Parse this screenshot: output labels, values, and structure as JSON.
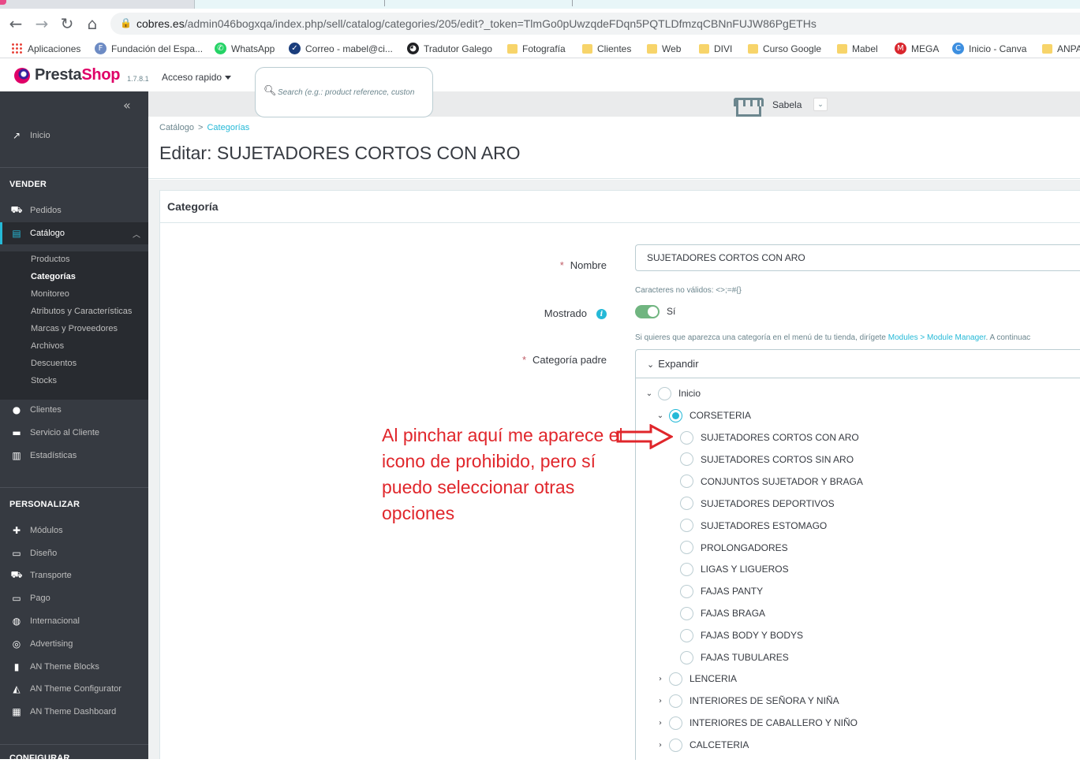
{
  "browser": {
    "url_host": "cobres.es",
    "url_path": "/admin046bogxqa/index.php/sell/catalog/categories/205/edit?_token=TlmGo0pUwzqdeFDqn5PQTLDfmzqCBNnFUJW86PgETHs",
    "bookmarks": [
      {
        "label": "Aplicaciones",
        "icon": "apps-grid-icon"
      },
      {
        "label": "Fundación del Espa...",
        "icon": "f-circle-icon",
        "color": "#6d8bc4"
      },
      {
        "label": "WhatsApp",
        "icon": "whatsapp-icon",
        "color": "#25d366"
      },
      {
        "label": "Correo - mabel@ci...",
        "icon": "mail-icon",
        "color": "#1a3d7c"
      },
      {
        "label": "Tradutor Galego",
        "icon": "globe-icon",
        "color": "#202124"
      },
      {
        "label": "Fotografía",
        "icon": "folder-icon"
      },
      {
        "label": "Clientes",
        "icon": "folder-icon"
      },
      {
        "label": "Web",
        "icon": "folder-icon"
      },
      {
        "label": "DIVI",
        "icon": "folder-icon"
      },
      {
        "label": "Curso Google",
        "icon": "folder-icon"
      },
      {
        "label": "Mabel",
        "icon": "folder-icon"
      },
      {
        "label": "MEGA",
        "icon": "mega-icon",
        "color": "#d9272e"
      },
      {
        "label": "Inicio - Canva",
        "icon": "canva-icon",
        "color": "#3d8fe0"
      },
      {
        "label": "ANPA",
        "icon": "folder-icon"
      }
    ]
  },
  "header": {
    "brand_pre": "Presta",
    "brand_post": "Shop",
    "version": "1.7.8.1",
    "quick_access": "Acceso rapido",
    "search_placeholder": "Search (e.g.: product reference, custon",
    "user": "Sabela"
  },
  "sidebar": {
    "collapse": "«",
    "inicio": "Inicio",
    "sections": {
      "vender": "VENDER",
      "personalizar": "PERSONALIZAR",
      "configurar": "CONFIGURAR"
    },
    "vender_items": [
      "Pedidos",
      "Catálogo"
    ],
    "catalog_sub": [
      "Productos",
      "Categorías",
      "Monitoreo",
      "Atributos y Características",
      "Marcas y Proveedores",
      "Archivos",
      "Descuentos",
      "Stocks"
    ],
    "vender_items2": [
      "Clientes",
      "Servicio al Cliente",
      "Estadísticas"
    ],
    "personalizar_items": [
      "Módulos",
      "Diseño",
      "Transporte",
      "Pago",
      "Internacional",
      "Advertising",
      "AN Theme Blocks",
      "AN Theme Configurator",
      "AN Theme Dashboard"
    ]
  },
  "page": {
    "breadcrumb": [
      "Catálogo",
      "Categorías"
    ],
    "title": "Editar: SUJETADORES CORTOS CON ARO",
    "card_title": "Categoría",
    "nombre_label": "Nombre",
    "nombre_value": "SUJETADORES CORTOS CON ARO",
    "nombre_hint": "Caracteres no válidos: <>;=#{}",
    "mostrado_label": "Mostrado",
    "mostrado_value": "Sí",
    "mostrado_hint_pre": "Si quieres que aparezca una categoría en el menú de tu tienda, dirígete ",
    "mostrado_hint_link": "Modules > Module Manager",
    "mostrado_hint_post": ". A continuac",
    "parent_label": "Categoría padre",
    "expand_label": "Expandir",
    "tree": {
      "root": "Inicio",
      "selected": "CORSETERIA",
      "children": [
        "SUJETADORES CORTOS CON ARO",
        "SUJETADORES CORTOS SIN ARO",
        "CONJUNTOS SUJETADOR Y BRAGA",
        "SUJETADORES DEPORTIVOS",
        "SUJETADORES ESTOMAGO",
        "PROLONGADORES",
        "LIGAS Y LIGUEROS",
        "FAJAS PANTY",
        "FAJAS BRAGA",
        "FAJAS BODY Y BODYS",
        "FAJAS TUBULARES"
      ],
      "siblings": [
        "LENCERIA",
        "INTERIORES DE SEÑORA Y NIÑA",
        "INTERIORES DE CABALLERO Y NIÑO",
        "CALCETERIA"
      ]
    }
  },
  "annotation": {
    "text": "Al pinchar aquí me aparece el icono de prohibido, pero sí puedo seleccionar otras opciones",
    "color": "#e0262b"
  }
}
